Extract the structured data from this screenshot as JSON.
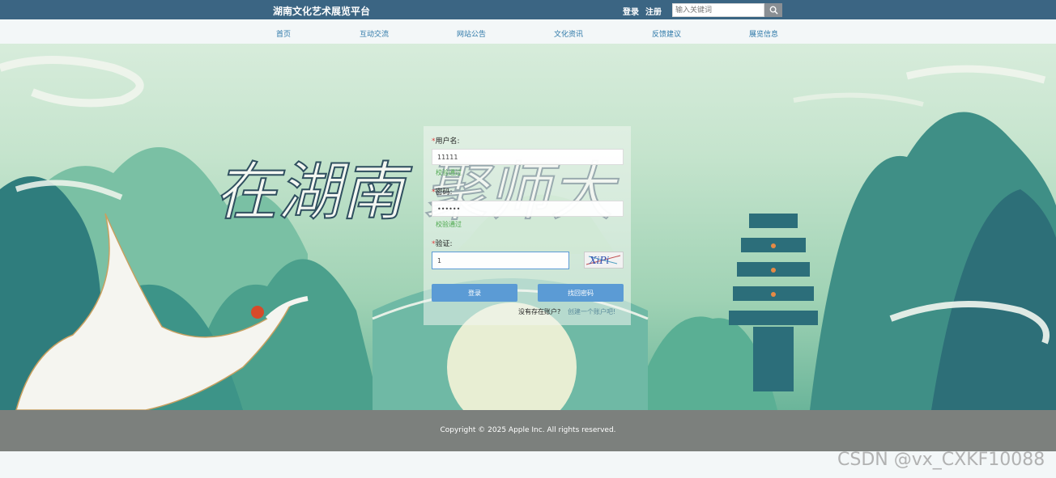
{
  "header": {
    "site_title": "湖南文化艺术展览平台",
    "login_link": "登录",
    "register_link": "注册",
    "search_placeholder": "输入关键词"
  },
  "nav": {
    "items": [
      {
        "label": "首页"
      },
      {
        "label": "互动交流"
      },
      {
        "label": "网站公告"
      },
      {
        "label": "文化资讯"
      },
      {
        "label": "反馈建议"
      },
      {
        "label": "展览信息"
      }
    ]
  },
  "hero": {
    "banner_text": "在湖南 聚师大"
  },
  "login_form": {
    "username_label": "用户名:",
    "username_value": "11111",
    "username_valid": "校验通过",
    "password_label": "密码:",
    "password_value": "123456",
    "password_valid": "校验通过",
    "captcha_label": "验证:",
    "captcha_value": "1",
    "captcha_text": "XiPi",
    "required_mark": "*",
    "login_button": "登录",
    "recover_button": "找回密码",
    "no_account_text": "没有存在账户?",
    "create_account_link": "创建一个账户吧!"
  },
  "footer": {
    "copyright": "Copyright © 2025 Apple Inc. All rights reserved."
  },
  "watermark": "CSDN @vx_CXKF10088",
  "colors": {
    "topbar": "#3b6583",
    "nav_text": "#2d78a8",
    "button": "#5b9bd5",
    "valid": "#4ca84c",
    "footer": "#7c807d"
  }
}
